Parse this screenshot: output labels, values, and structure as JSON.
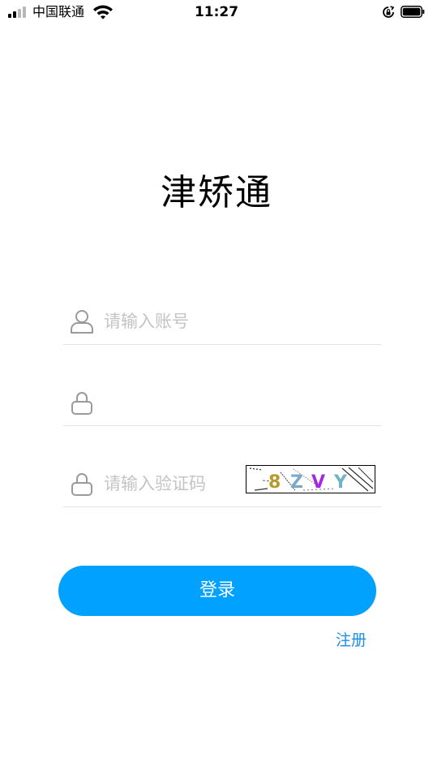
{
  "status_bar": {
    "carrier": "中国联通",
    "time": "11:27",
    "icons": [
      "signal-icon",
      "wifi-icon",
      "rotation-lock-icon",
      "battery-icon"
    ]
  },
  "app": {
    "title": "津矫通"
  },
  "form": {
    "account_placeholder": "请输入账号",
    "password_value": "",
    "captcha_placeholder": "请输入验证码",
    "captcha_text": "8ZVY"
  },
  "actions": {
    "login_label": "登录",
    "register_label": "注册"
  },
  "colors": {
    "primary": "#00a1ff",
    "link": "#1a8fe8",
    "placeholder": "#c4c4c4",
    "divider": "#e3e3e3"
  }
}
